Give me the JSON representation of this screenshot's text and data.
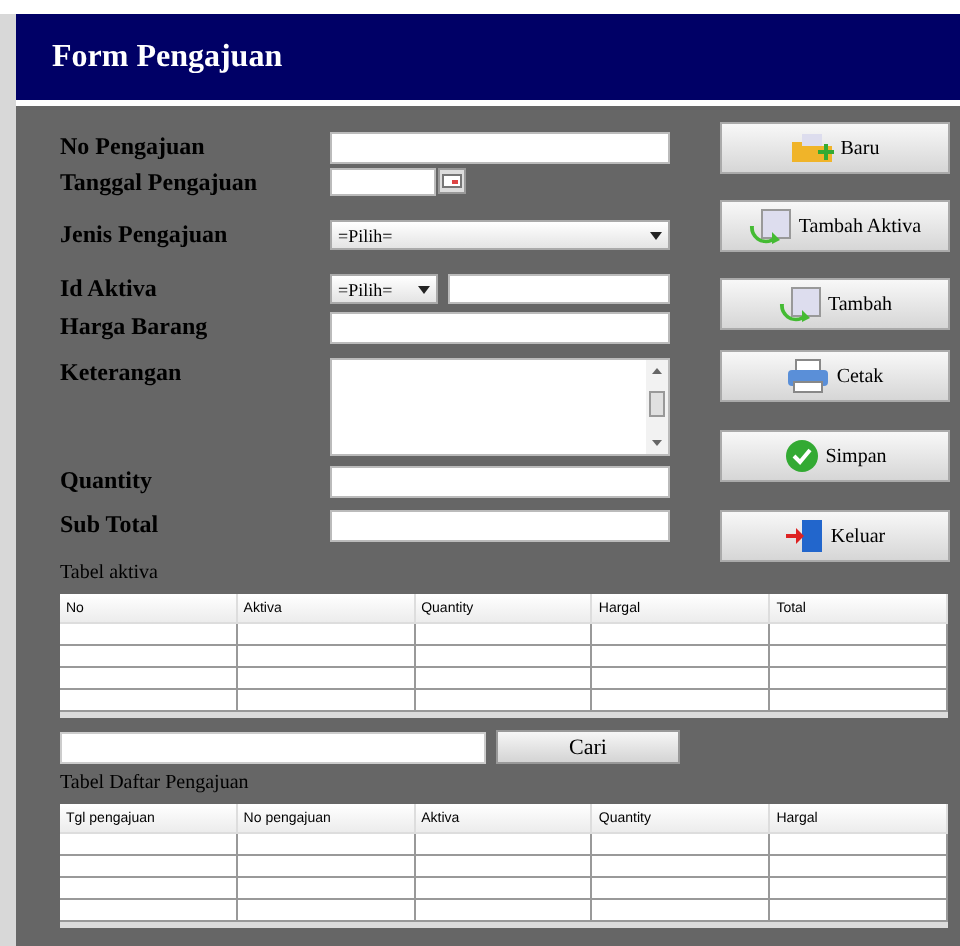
{
  "window": {
    "title": "Form Pengajuan"
  },
  "fields": [
    {
      "label": "No Pengajuan",
      "kind": "text"
    },
    {
      "label": "Tanggal Pengajuan",
      "kind": "date"
    },
    {
      "label": "Jenis Pengajuan",
      "kind": "select",
      "value": "=Pilih="
    },
    {
      "label": "Id Aktiva",
      "kind": "select_text",
      "value": "=Pilih="
    },
    {
      "label": "Harga Barang",
      "kind": "text"
    },
    {
      "label": "Keterangan",
      "kind": "textarea"
    },
    {
      "label": "Quantity",
      "kind": "text"
    },
    {
      "label": "Sub Total",
      "kind": "text"
    }
  ],
  "buttons": [
    {
      "label": "Baru",
      "kind": "new"
    },
    {
      "label": "Tambah Aktiva",
      "kind": "add"
    },
    {
      "label": "Tambah",
      "kind": "add"
    },
    {
      "label": "Cetak",
      "kind": "print"
    },
    {
      "label": "Simpan",
      "kind": "save"
    },
    {
      "label": "Keluar",
      "kind": "exit"
    }
  ],
  "table_aktiva": {
    "title": "Tabel aktiva",
    "columns": [
      "No",
      "Aktiva",
      "Quantity",
      "Hargal",
      "Total"
    ]
  },
  "search": {
    "button": "Cari"
  },
  "table_pengajuan": {
    "title": "Tabel Daftar Pengajuan",
    "columns": [
      "Tgl pengajuan",
      "No pengajuan",
      "Aktiva",
      "Quantity",
      "Hargal"
    ]
  }
}
